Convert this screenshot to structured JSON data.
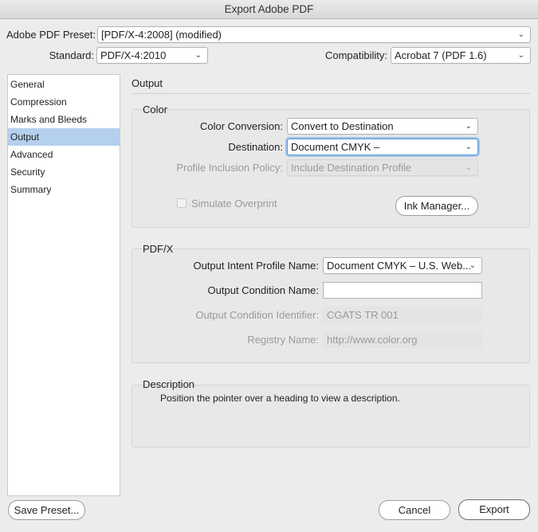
{
  "window": {
    "title": "Export Adobe PDF"
  },
  "preset": {
    "label": "Adobe PDF Preset:",
    "value": "[PDF/X-4:2008] (modified)"
  },
  "standard": {
    "label": "Standard:",
    "value": "PDF/X-4:2010"
  },
  "compatibility": {
    "label": "Compatibility:",
    "value": "Acrobat 7 (PDF 1.6)"
  },
  "sidebar": {
    "items": [
      {
        "label": "General"
      },
      {
        "label": "Compression"
      },
      {
        "label": "Marks and Bleeds"
      },
      {
        "label": "Output"
      },
      {
        "label": "Advanced"
      },
      {
        "label": "Security"
      },
      {
        "label": "Summary"
      }
    ]
  },
  "main": {
    "title": "Output",
    "color": {
      "title": "Color",
      "conversion_label": "Color Conversion:",
      "conversion_value": "Convert to Destination",
      "destination_label": "Destination:",
      "destination_value": "Document CMYK –",
      "profile_label": "Profile Inclusion Policy:",
      "profile_value": "Include Destination Profile",
      "simulate_label": "Simulate Overprint",
      "ink_manager_label": "Ink Manager..."
    },
    "pdfx": {
      "title": "PDF/X",
      "intent_label": "Output Intent Profile Name:",
      "intent_value": "Document CMYK – U.S. Web...",
      "condition_name_label": "Output Condition Name:",
      "condition_name_value": "",
      "condition_id_label": "Output Condition Identifier:",
      "condition_id_value": "CGATS TR 001",
      "registry_label": "Registry Name:",
      "registry_value": "http://www.color.org"
    },
    "description": {
      "title": "Description",
      "text": "Position the pointer over a heading to view a description."
    }
  },
  "footer": {
    "save_preset_label": "Save Preset...",
    "cancel_label": "Cancel",
    "export_label": "Export"
  },
  "colors": {
    "selection": "#b5d0ee",
    "focus": "#5b9bd5"
  }
}
